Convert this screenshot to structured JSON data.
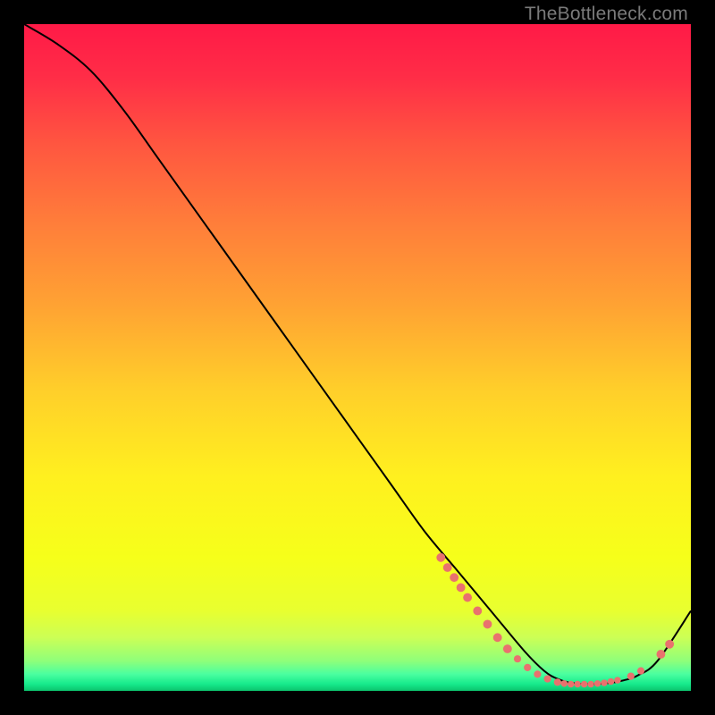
{
  "watermark": "TheBottleneck.com",
  "chart_data": {
    "type": "line",
    "title": "",
    "xlabel": "",
    "ylabel": "",
    "xlim": [
      0,
      100
    ],
    "ylim": [
      0,
      100
    ],
    "series": [
      {
        "name": "bottleneck-curve",
        "x": [
          0,
          5,
          10,
          15,
          20,
          25,
          30,
          35,
          40,
          45,
          50,
          55,
          60,
          65,
          70,
          75,
          78,
          80,
          82,
          85,
          88,
          90,
          92,
          95,
          100
        ],
        "y": [
          100,
          97,
          93,
          87,
          80,
          73,
          66,
          59,
          52,
          45,
          38,
          31,
          24,
          18,
          12,
          6,
          3,
          1.8,
          1.2,
          1.0,
          1.2,
          1.6,
          2.3,
          4.5,
          12
        ]
      }
    ],
    "marker_points": {
      "name": "highlight-dots",
      "color": "#e9716e",
      "points": [
        {
          "x": 62.5,
          "y": 20.0,
          "r": 1.2
        },
        {
          "x": 63.5,
          "y": 18.5,
          "r": 1.2
        },
        {
          "x": 64.5,
          "y": 17.0,
          "r": 1.2
        },
        {
          "x": 65.5,
          "y": 15.5,
          "r": 1.2
        },
        {
          "x": 66.5,
          "y": 14.0,
          "r": 1.2
        },
        {
          "x": 68.0,
          "y": 12.0,
          "r": 1.2
        },
        {
          "x": 69.5,
          "y": 10.0,
          "r": 1.2
        },
        {
          "x": 71.0,
          "y": 8.0,
          "r": 1.2
        },
        {
          "x": 72.5,
          "y": 6.3,
          "r": 1.2
        },
        {
          "x": 74.0,
          "y": 4.8,
          "r": 1.0
        },
        {
          "x": 75.5,
          "y": 3.5,
          "r": 1.0
        },
        {
          "x": 77.0,
          "y": 2.5,
          "r": 1.0
        },
        {
          "x": 78.5,
          "y": 1.8,
          "r": 1.0
        },
        {
          "x": 80.0,
          "y": 1.3,
          "r": 1.0
        },
        {
          "x": 81.0,
          "y": 1.1,
          "r": 0.9
        },
        {
          "x": 82.0,
          "y": 1.0,
          "r": 0.9
        },
        {
          "x": 83.0,
          "y": 1.0,
          "r": 0.9
        },
        {
          "x": 84.0,
          "y": 1.0,
          "r": 0.9
        },
        {
          "x": 85.0,
          "y": 1.0,
          "r": 0.9
        },
        {
          "x": 86.0,
          "y": 1.1,
          "r": 0.9
        },
        {
          "x": 87.0,
          "y": 1.2,
          "r": 0.9
        },
        {
          "x": 88.0,
          "y": 1.4,
          "r": 0.9
        },
        {
          "x": 89.0,
          "y": 1.6,
          "r": 0.9
        },
        {
          "x": 91.0,
          "y": 2.2,
          "r": 1.0
        },
        {
          "x": 92.5,
          "y": 3.0,
          "r": 1.0
        },
        {
          "x": 95.5,
          "y": 5.5,
          "r": 1.2
        },
        {
          "x": 96.8,
          "y": 7.0,
          "r": 1.2
        }
      ]
    },
    "gradient_stops": [
      {
        "offset": 0.0,
        "color": "#ff1a47"
      },
      {
        "offset": 0.08,
        "color": "#ff2d47"
      },
      {
        "offset": 0.18,
        "color": "#ff5640"
      },
      {
        "offset": 0.3,
        "color": "#ff7e3a"
      },
      {
        "offset": 0.42,
        "color": "#ffa233"
      },
      {
        "offset": 0.55,
        "color": "#ffcf2a"
      },
      {
        "offset": 0.68,
        "color": "#fff01f"
      },
      {
        "offset": 0.8,
        "color": "#f6ff1a"
      },
      {
        "offset": 0.88,
        "color": "#e8ff30"
      },
      {
        "offset": 0.92,
        "color": "#ccff55"
      },
      {
        "offset": 0.955,
        "color": "#8fff7a"
      },
      {
        "offset": 0.975,
        "color": "#4affa0"
      },
      {
        "offset": 0.99,
        "color": "#16e98b"
      },
      {
        "offset": 1.0,
        "color": "#0cc46d"
      }
    ]
  }
}
